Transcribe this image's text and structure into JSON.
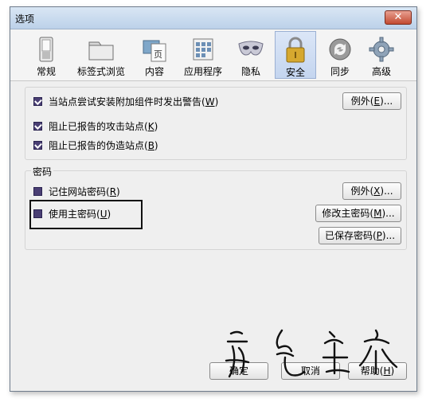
{
  "window": {
    "title": "选项",
    "close_symbol": "✕"
  },
  "tabs": [
    {
      "label": "常规",
      "icon": "switch-icon"
    },
    {
      "label": "标签式浏览",
      "icon": "folder-tabs-icon"
    },
    {
      "label": "内容",
      "icon": "content-page-icon"
    },
    {
      "label": "应用程序",
      "icon": "applications-icon"
    },
    {
      "label": "隐私",
      "icon": "privacy-mask-icon"
    },
    {
      "label": "安全",
      "icon": "padlock-icon",
      "selected": true
    },
    {
      "label": "同步",
      "icon": "sync-icon"
    },
    {
      "label": "高级",
      "icon": "gear-icon"
    }
  ],
  "security": {
    "warn_addon": {
      "label_pre": "当站点尝试安装附加组件时发出警告(",
      "key": "W",
      "label_post": ")",
      "checked": true
    },
    "block_attack": {
      "label_pre": "阻止已报告的攻击站点(",
      "key": "K",
      "label_post": ")",
      "checked": true
    },
    "block_forgery": {
      "label_pre": "阻止已报告的伪造站点(",
      "key": "B",
      "label_post": ")",
      "checked": true
    },
    "exceptions_button": {
      "pre": "例外(",
      "key": "E",
      "post": ")..."
    }
  },
  "passwords": {
    "legend": "密码",
    "remember": {
      "label_pre": "记住网站密码(",
      "key": "R",
      "label_post": ")",
      "checked": false
    },
    "master": {
      "label_pre": "使用主密码(",
      "key": "U",
      "label_post": ")",
      "checked": false
    },
    "exceptions_button": {
      "pre": "例外(",
      "key": "X",
      "post": ")..."
    },
    "change_master_button": {
      "pre": "修改主密码(",
      "key": "M",
      "post": ")..."
    },
    "saved_button": {
      "pre": "已保存密码(",
      "key": "P",
      "post": ")..."
    }
  },
  "footer": {
    "ok_button": {
      "pre": "确定",
      "key": "",
      "post": ""
    },
    "cancel_button": {
      "pre": "取消",
      "key": "",
      "post": ""
    },
    "help_button": {
      "pre": "帮助(",
      "key": "H",
      "post": ")"
    }
  },
  "colors": {
    "checkbox": "#4a3f74",
    "selected_tab": "#c4d5ef",
    "window_bg": "#efefef"
  }
}
